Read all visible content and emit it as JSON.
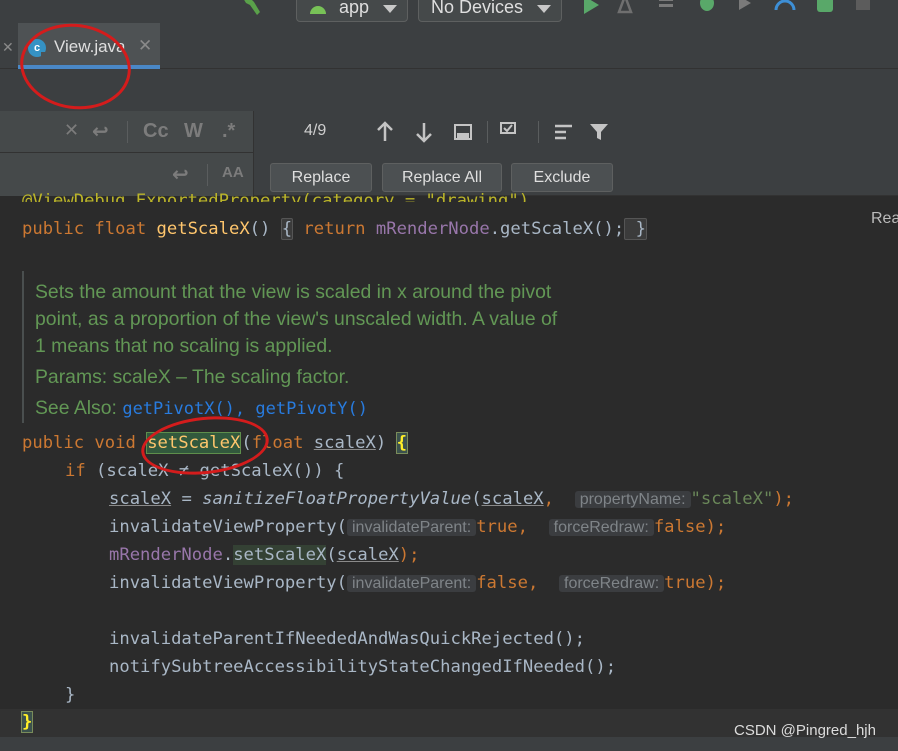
{
  "toolbar": {
    "run_config": "app",
    "device": "No Devices",
    "icons": [
      "build-hammer-icon",
      "run-icon",
      "apply-changes-icon",
      "sync-icon",
      "debug-icon",
      "attach-debugger-icon",
      "profile-icon",
      "device-manager-icon",
      "stop-icon"
    ]
  },
  "tab": {
    "title": "View.java",
    "close": "✕",
    "file_icon_letter": "c"
  },
  "find": {
    "match_count": "4/9",
    "case_label": "Cc",
    "word_label": "W",
    "regex_label": ".*",
    "preserve_case_label": "AA"
  },
  "replace_buttons": {
    "replace": "Replace",
    "replace_all": "Replace All",
    "exclude": "Exclude"
  },
  "right_partial_text": "Rea",
  "code": {
    "line0": "@ViewDebug.ExportedProperty(category = \"drawing\")",
    "line1_kw1": "public float ",
    "line1_fn": "getScaleX",
    "line1_rest": "() ",
    "line1_brace_open": "{",
    "line1_return": " return ",
    "line1_field": "mRenderNode",
    "line1_call": ".getScaleX();",
    "line1_brace_close": " }",
    "doc_line1": "Sets the amount that the view is scaled in x around the pivot",
    "doc_line2": "point, as a proportion of the view's unscaled width. A value of",
    "doc_line3": "1 means that no scaling is applied.",
    "doc_params": "Params:   scaleX – The scaling factor.",
    "doc_see_also": "See Also: ",
    "doc_link1": "getPivotX()",
    "doc_link_sep": ", ",
    "doc_link2": "getPivotY()",
    "sig_kw": "public void ",
    "sig_fn": "setScaleX",
    "sig_paren": "(",
    "sig_kw2": "float ",
    "sig_param": "scaleX",
    "sig_close": ") ",
    "sig_brace": "{",
    "if_kw": "if ",
    "if_cond": "(scaleX ≠ getScaleX()) {",
    "assign_var": "scaleX",
    "assign_eq": " = ",
    "assign_fn": "sanitizeFloatPropertyValue",
    "assign_open": "(",
    "assign_arg": "scaleX",
    "assign_comma": ", ",
    "assign_hint": "propertyName:",
    "assign_str": "\"scaleX\"",
    "assign_close": ");",
    "inv1_call": "invalidateViewProperty(",
    "inv1_hint1": "invalidateParent:",
    "inv1_val1": "true",
    "inv1_comma": ", ",
    "inv1_hint2": "forceRedraw:",
    "inv1_val2": "false",
    "inv1_close": ");",
    "rn_field": "mRenderNode",
    "rn_dot": ".",
    "rn_fn": "setScaleX",
    "rn_open": "(",
    "rn_arg": "scaleX",
    "rn_close": ");",
    "inv2_call": "invalidateViewProperty(",
    "inv2_hint1": "invalidateParent:",
    "inv2_val1": "false",
    "inv2_comma": ", ",
    "inv2_hint2": "forceRedraw:",
    "inv2_val2": "true",
    "inv2_close": ");",
    "call1": "invalidateParentIfNeededAndWasQuickRejected();",
    "call2": "notifySubtreeAccessibilityStateChangedIfNeeded();",
    "close_if": "}",
    "close_method": "}"
  },
  "watermark": "CSDN @Pingred_hjh"
}
